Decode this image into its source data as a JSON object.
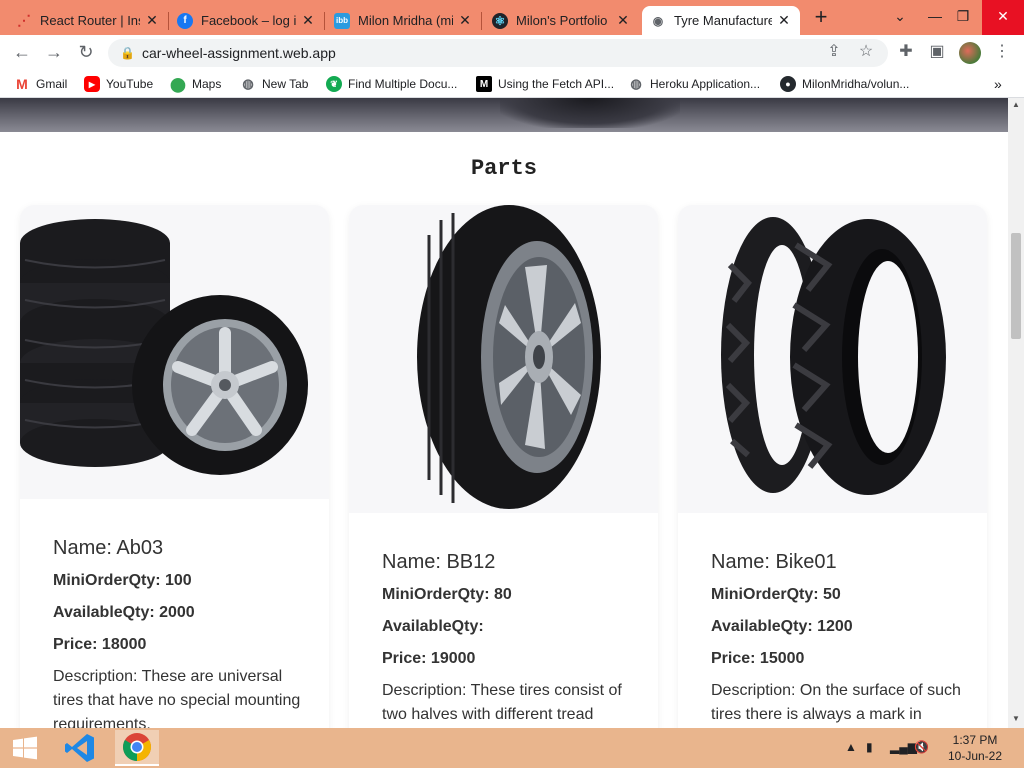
{
  "tabs": [
    {
      "title": "React Router | Ins",
      "icon": "react-router-icon",
      "color": "#d0312d"
    },
    {
      "title": "Facebook – log in",
      "icon": "facebook-icon",
      "color": "#1877f2"
    },
    {
      "title": "Milon Mridha (mi",
      "icon": "ibb-icon",
      "color": "#2b9be0"
    },
    {
      "title": "Milon's Portfolio",
      "icon": "react-icon",
      "color": "#20232a"
    },
    {
      "title": "Tyre Manufacture",
      "icon": "globe-icon",
      "color": "#5f6368"
    }
  ],
  "toolbar": {
    "url": "car-wheel-assignment.web.app"
  },
  "bookmarks": [
    {
      "label": "Gmail",
      "icon": "gmail-icon"
    },
    {
      "label": "YouTube",
      "icon": "youtube-icon"
    },
    {
      "label": "Maps",
      "icon": "maps-icon"
    },
    {
      "label": "New Tab",
      "icon": "globe-icon"
    },
    {
      "label": "Find Multiple Docu...",
      "icon": "mongodb-icon"
    },
    {
      "label": "Using the Fetch API...",
      "icon": "mdn-icon"
    },
    {
      "label": "Heroku Application...",
      "icon": "globe-icon"
    },
    {
      "label": "MilonMridha/volun...",
      "icon": "github-icon"
    }
  ],
  "page": {
    "section_title": "Parts",
    "parts": [
      {
        "name": "Name: Ab03",
        "min_order": "MiniOrderQty: 100",
        "available": "AvailableQty: 2000",
        "price": "Price: 18000",
        "description": "Description: These are universal tires that have no special mounting requirements."
      },
      {
        "name": "Name: BB12",
        "min_order": "MiniOrderQty: 80",
        "available": "AvailableQty:",
        "price": "Price: 19000",
        "description": "Description: These tires consist of two halves with different tread"
      },
      {
        "name": "Name: Bike01",
        "min_order": "MiniOrderQty: 50",
        "available": "AvailableQty: 1200",
        "price": "Price: 15000",
        "description": "Description: On the surface of such tires there is always a mark in"
      }
    ]
  },
  "taskbar": {
    "time": "1:37 PM",
    "date": "10-Jun-22"
  },
  "colors": {
    "tab_strip": "#f28b6e",
    "taskbar": "#e9b58d",
    "close_button": "#e81123"
  }
}
